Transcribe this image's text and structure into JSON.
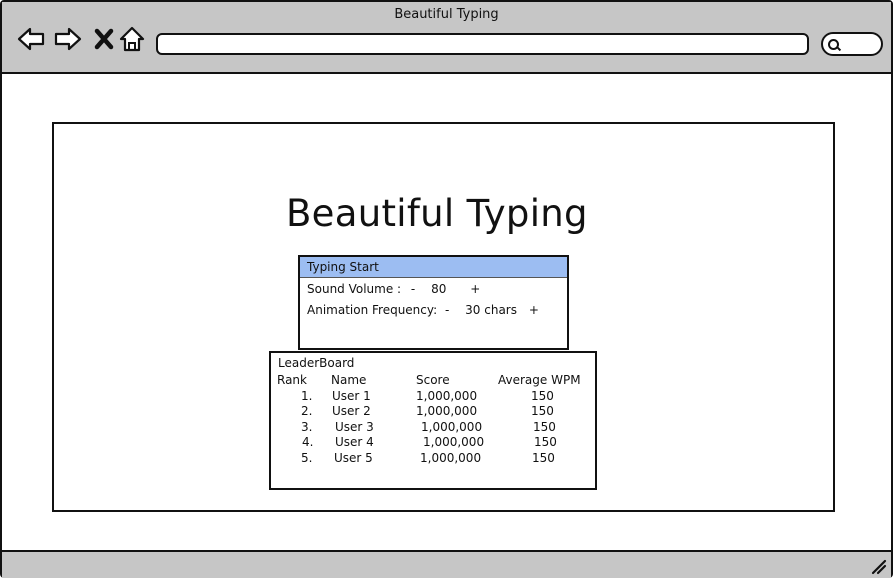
{
  "window": {
    "title": "Beautiful Typing"
  },
  "icons": {
    "back": "back-arrow-icon",
    "forward": "forward-arrow-icon",
    "close": "close-icon",
    "home": "home-icon",
    "search": "search-icon",
    "resize": "resize-grip-icon"
  },
  "page": {
    "title": "Beautiful Typing",
    "settings": {
      "header": "Typing Start",
      "volume_label": "Sound Volume :",
      "volume_minus": "-",
      "volume_value": "80",
      "volume_plus": "+",
      "anim_label": "Animation Frequency:",
      "anim_minus": "-",
      "anim_value": "30 chars",
      "anim_plus": "+"
    },
    "leaderboard": {
      "title": "LeaderBoard",
      "columns": [
        "Rank",
        "Name",
        "Score",
        "Average WPM"
      ],
      "rows": [
        [
          "1.",
          "User 1",
          "1,000,000",
          "150"
        ],
        [
          "2.",
          "User 2",
          "1,000,000",
          "150"
        ],
        [
          "3.",
          "User 3",
          "1,000,000",
          "150"
        ],
        [
          "4.",
          "User 4",
          "1,000,000",
          "150"
        ],
        [
          "5.",
          "User 5",
          "1,000,000",
          "150"
        ]
      ]
    }
  },
  "colors": {
    "chrome": "#c6c6c6",
    "header_highlight": "#9cbdf2"
  }
}
